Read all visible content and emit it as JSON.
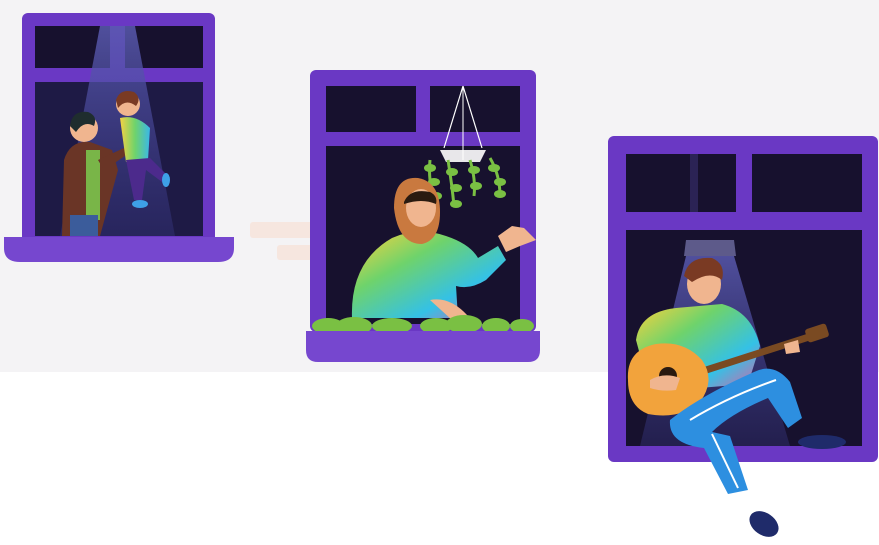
{
  "scene": {
    "colors": {
      "wall": "#f4f3f5",
      "window_frame": "#6a38c4",
      "window_sill": "#7647cf",
      "window_dark": "#17112e",
      "window_lit": "#2a2660",
      "light_beam": "#3b3a8a",
      "plant": "#7ac043",
      "skin": "#f0b58f",
      "jeans": "#2d8fe0",
      "hair_brown": "#7a3a23",
      "guitar": "#f2a33c"
    },
    "windows": [
      {
        "name": "window-parent-child",
        "icon": "parent-lifting-child"
      },
      {
        "name": "window-woman-plant",
        "icon": "woman-in-hijab-waving"
      },
      {
        "name": "window-guitarist",
        "icon": "man-playing-guitar"
      }
    ]
  }
}
